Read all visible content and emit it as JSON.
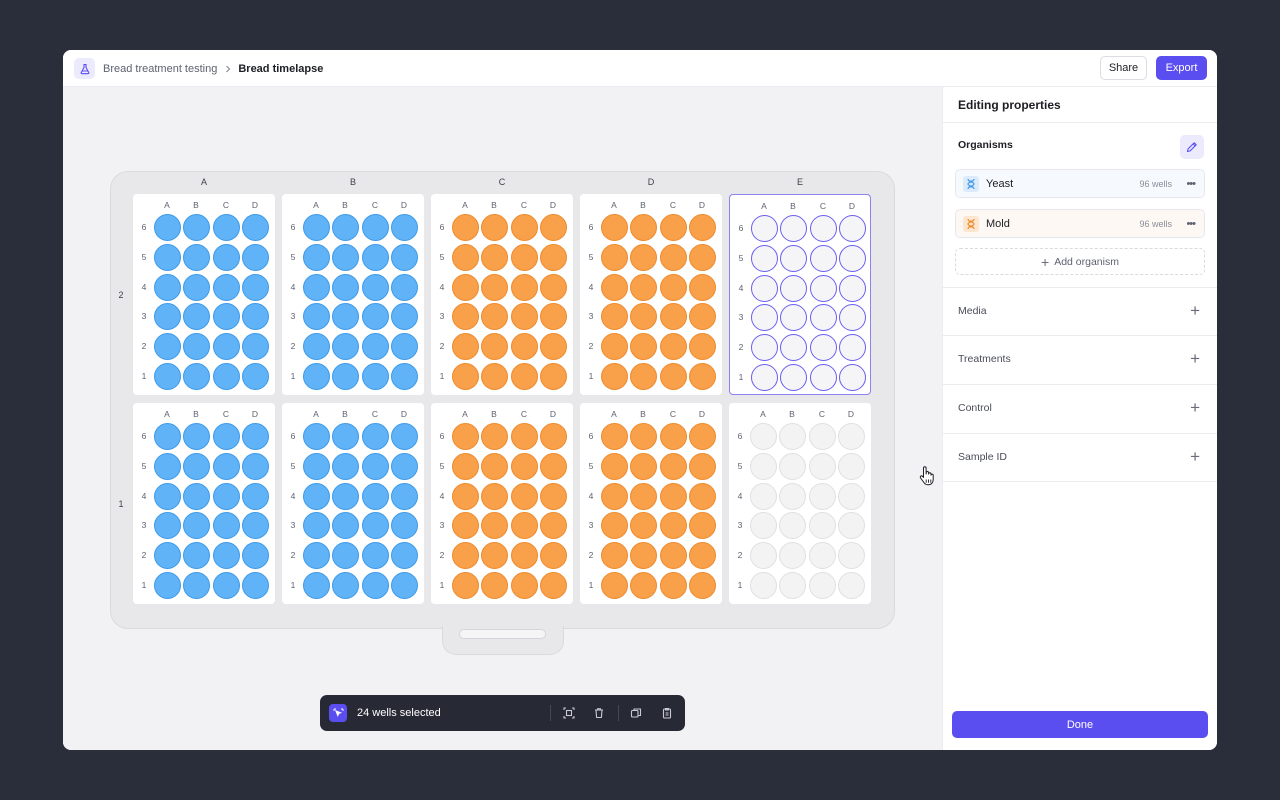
{
  "breadcrumb": {
    "parent": "Bread treatment testing",
    "current": "Bread timelapse"
  },
  "header": {
    "share_label": "Share",
    "export_label": "Export"
  },
  "tray": {
    "column_labels": [
      "A",
      "B",
      "C",
      "D",
      "E"
    ],
    "row_labels": [
      "2",
      "1"
    ]
  },
  "plate": {
    "column_labels": [
      "A",
      "B",
      "C",
      "D"
    ],
    "row_labels": [
      "6",
      "5",
      "4",
      "3",
      "2",
      "1"
    ]
  },
  "plates": [
    {
      "tray_row": "2",
      "tray_col": "A",
      "state": "blue"
    },
    {
      "tray_row": "2",
      "tray_col": "B",
      "state": "blue"
    },
    {
      "tray_row": "2",
      "tray_col": "C",
      "state": "orange"
    },
    {
      "tray_row": "2",
      "tray_col": "D",
      "state": "orange"
    },
    {
      "tray_row": "2",
      "tray_col": "E",
      "state": "sel"
    },
    {
      "tray_row": "1",
      "tray_col": "A",
      "state": "blue"
    },
    {
      "tray_row": "1",
      "tray_col": "B",
      "state": "blue"
    },
    {
      "tray_row": "1",
      "tray_col": "C",
      "state": "orange"
    },
    {
      "tray_row": "1",
      "tray_col": "D",
      "state": "orange"
    },
    {
      "tray_row": "1",
      "tray_col": "E",
      "state": "empty"
    }
  ],
  "selection_bar": {
    "text": "24 wells selected",
    "icons": [
      "select-pointer-icon",
      "select-region-icon",
      "trash-icon",
      "duplicate-icon",
      "clipboard-icon"
    ]
  },
  "panel": {
    "title": "Editing properties",
    "organisms_title": "Organisms",
    "organisms": [
      {
        "name": "Yeast",
        "count": "96 wells",
        "color": "#3f9ae8",
        "icon": "dna-icon"
      },
      {
        "name": "Mold",
        "count": "96 wells",
        "color": "#ee8a2c",
        "icon": "dna-icon"
      }
    ],
    "add_organism_label": "Add organism",
    "sections": [
      "Media",
      "Treatments",
      "Control",
      "Sample ID"
    ],
    "done_label": "Done"
  },
  "colors": {
    "accent": "#5b4ef0",
    "yeast_well": "#5fb3f6",
    "mold_well": "#f9a04b",
    "background": "#2a2d3a"
  }
}
